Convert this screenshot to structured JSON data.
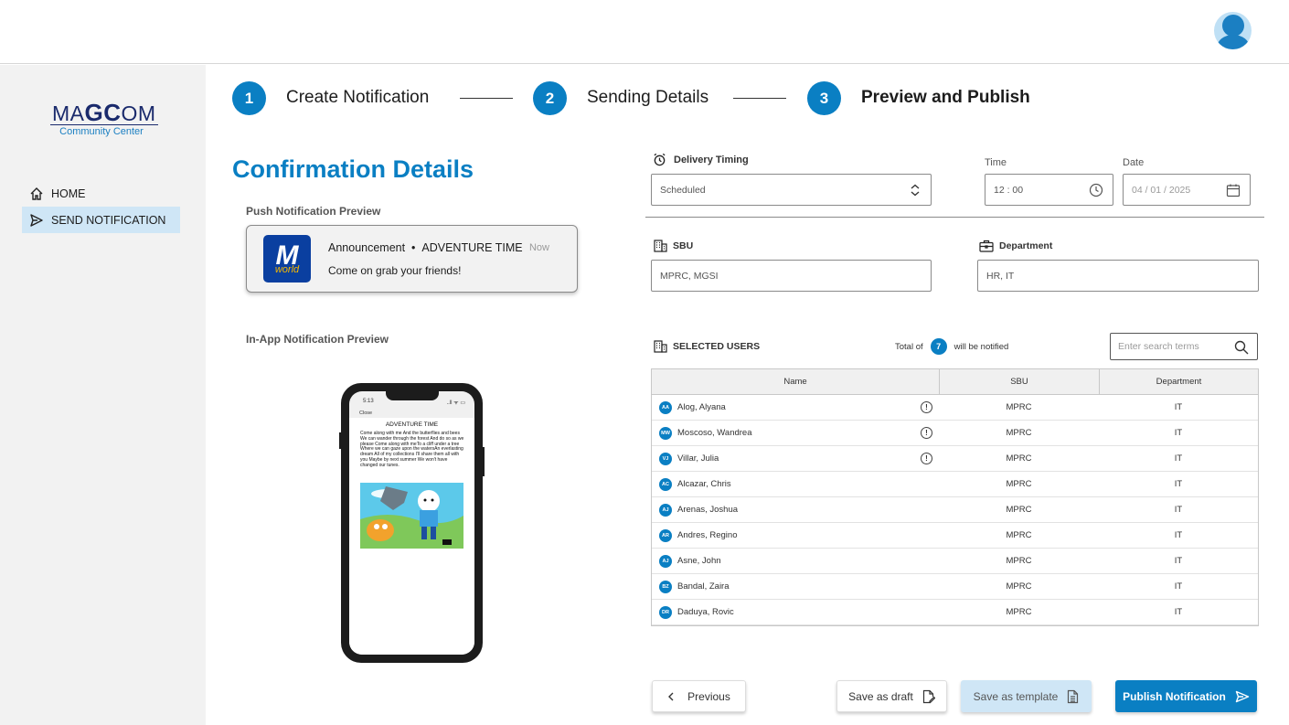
{
  "colors": {
    "accent": "#0a7fc3",
    "active_nav_bg": "#cfe6f6",
    "sidebar_bg": "#f2f2f2"
  },
  "header": {
    "avatar_icon": "user-avatar-icon"
  },
  "logo": {
    "brand_pre": "MA",
    "brand_mid": "GC",
    "brand_post": "OM",
    "subtitle": "Community Center"
  },
  "sidebar": {
    "items": [
      {
        "label": "HOME",
        "icon": "home-icon",
        "active": false
      },
      {
        "label": "SEND NOTIFICATION",
        "icon": "send-icon",
        "active": true
      }
    ]
  },
  "stepper": {
    "steps": [
      {
        "number": "1",
        "label": "Create Notification"
      },
      {
        "number": "2",
        "label": "Sending Details"
      },
      {
        "number": "3",
        "label": "Preview and Publish"
      }
    ],
    "current": 3
  },
  "main": {
    "title": "Confirmation Details",
    "push_preview_label": "Push Notification Preview",
    "inapp_preview_label": "In-App Notification Preview"
  },
  "push": {
    "app_letter": "M",
    "app_word": "world",
    "category": "Announcement",
    "separator": "•",
    "title": "ADVENTURE TIME",
    "time": "Now",
    "body": "Come on grab your friends!"
  },
  "inapp": {
    "status_time": "5:13",
    "status_icons": "..ll ᯤ ▭",
    "close_label": "Close",
    "title": "ADVENTURE TIME",
    "body": "Come along with me And the butterflies and bees We can wander through the forest And do so as we please Come along with meTo a cliff under a tree Where we can gaze upon the watersAn everlasting dream All of my collections I'll share them all with you Maybe by next summer We won't have changed our tunes."
  },
  "delivery": {
    "label": "Delivery Timing",
    "value": "Scheduled",
    "time_label": "Time",
    "time_value": "12 : 00",
    "date_label": "Date",
    "date_value": "04 / 01 / 2025"
  },
  "sbu": {
    "label": "SBU",
    "value": "MPRC, MGSI"
  },
  "department": {
    "label": "Department",
    "value": "HR, IT"
  },
  "users": {
    "label": "SELECTED USERS",
    "total_prefix": "Total of",
    "total_count": "7",
    "total_suffix": "will be notified",
    "search_placeholder": "Enter search terms",
    "columns": [
      "Name",
      "SBU",
      "Department"
    ],
    "rows": [
      {
        "initials": "AA",
        "name": "Alog, Alyana",
        "warning": true,
        "sbu": "MPRC",
        "dept": "IT"
      },
      {
        "initials": "MW",
        "name": "Moscoso, Wandrea",
        "warning": true,
        "sbu": "MPRC",
        "dept": "IT"
      },
      {
        "initials": "VJ",
        "name": "Villar, Julia",
        "warning": true,
        "sbu": "MPRC",
        "dept": "IT"
      },
      {
        "initials": "AC",
        "name": "Alcazar, Chris",
        "warning": false,
        "sbu": "MPRC",
        "dept": "IT"
      },
      {
        "initials": "AJ",
        "name": "Arenas, Joshua",
        "warning": false,
        "sbu": "MPRC",
        "dept": "IT"
      },
      {
        "initials": "AR",
        "name": "Andres, Regino",
        "warning": false,
        "sbu": "MPRC",
        "dept": "IT"
      },
      {
        "initials": "AJ",
        "name": "Asne, John",
        "warning": false,
        "sbu": "MPRC",
        "dept": "IT"
      },
      {
        "initials": "BZ",
        "name": "Bandal, Zaira",
        "warning": false,
        "sbu": "MPRC",
        "dept": "IT"
      },
      {
        "initials": "DR",
        "name": "Daduya, Rovic",
        "warning": false,
        "sbu": "MPRC",
        "dept": "IT"
      }
    ]
  },
  "actions": {
    "previous": "Previous",
    "save_draft": "Save as draft",
    "save_template": "Save as template",
    "publish": "Publish Notification"
  }
}
